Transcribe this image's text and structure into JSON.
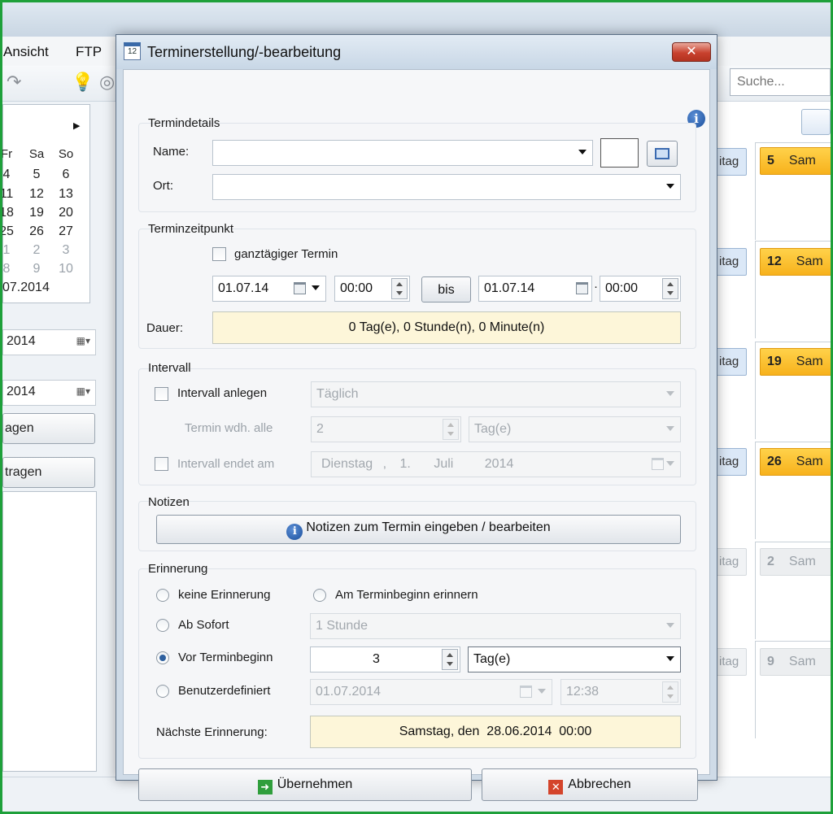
{
  "menu": {
    "ansicht": "Ansicht",
    "ftp": "FTP"
  },
  "search": {
    "placeholder": "Suche..."
  },
  "mini_calendar": {
    "headers": [
      "Fr",
      "Sa",
      "So"
    ],
    "rows": [
      [
        "4",
        "5",
        "6"
      ],
      [
        "11",
        "12",
        "13"
      ],
      [
        "18",
        "19",
        "20"
      ],
      [
        "25",
        "26",
        "27"
      ],
      [
        "1",
        "2",
        "3"
      ],
      [
        "8",
        "9",
        "10"
      ]
    ],
    "footer": "07.2014"
  },
  "sidebar": {
    "date1": "2014",
    "date2": "2014",
    "button1": "agen",
    "button2": "tragen"
  },
  "calendar": {
    "chip_label": "itag",
    "days": [
      {
        "num": "5",
        "label": "Sam"
      },
      {
        "num": "12",
        "label": "Sam"
      },
      {
        "num": "19",
        "label": "Sam"
      },
      {
        "num": "26",
        "label": "Sam"
      },
      {
        "num": "2",
        "label": "Sam"
      },
      {
        "num": "9",
        "label": "Sam"
      }
    ],
    "today_color": "#f7b21c"
  },
  "dialog": {
    "title": "Terminerstellung/-bearbeitung",
    "icon_text": "12",
    "termindetails": {
      "group": "Termindetails",
      "name_label": "Name:",
      "name_value": "",
      "ort_label": "Ort:",
      "ort_value": ""
    },
    "terminzeitpunkt": {
      "group": "Terminzeitpunkt",
      "allday_label": "ganztägiger Termin",
      "start_date": "01.07.14",
      "start_time": "00:00",
      "bis_label": "bis",
      "end_date": "01.07.14",
      "end_time": "00:00",
      "dauer_label": "Dauer:",
      "dauer_value": "0 Tag(e), 0 Stunde(n), 0 Minute(n)"
    },
    "intervall": {
      "group": "Intervall",
      "create_label": "Intervall anlegen",
      "frequency": "Täglich",
      "repeat_label": "Termin wdh. alle",
      "repeat_value": "2",
      "repeat_unit": "Tag(e)",
      "end_label": "Intervall endet am",
      "end_weekday": "Dienstag",
      "end_sep": ",",
      "end_day": "1.",
      "end_month": "Juli",
      "end_year": "2014"
    },
    "notizen": {
      "group": "Notizen",
      "button": "Notizen zum Termin eingeben / bearbeiten"
    },
    "erinnerung": {
      "group": "Erinnerung",
      "option_none": "keine Erinnerung",
      "option_start": "Am Terminbeginn erinnern",
      "option_now": "Ab Sofort",
      "now_value": "1 Stunde",
      "option_before": "Vor Terminbeginn",
      "before_value": "3",
      "before_unit": "Tag(e)",
      "option_custom": "Benutzerdefiniert",
      "custom_date": "01.07.2014",
      "custom_time": "12:38",
      "next_label": "Nächste Erinnerung:",
      "next_value": "Samstag, den  28.06.2014  00:00",
      "selected": "Vor Terminbeginn"
    },
    "ok_button": "Übernehmen",
    "cancel_button": "Abbrechen"
  }
}
